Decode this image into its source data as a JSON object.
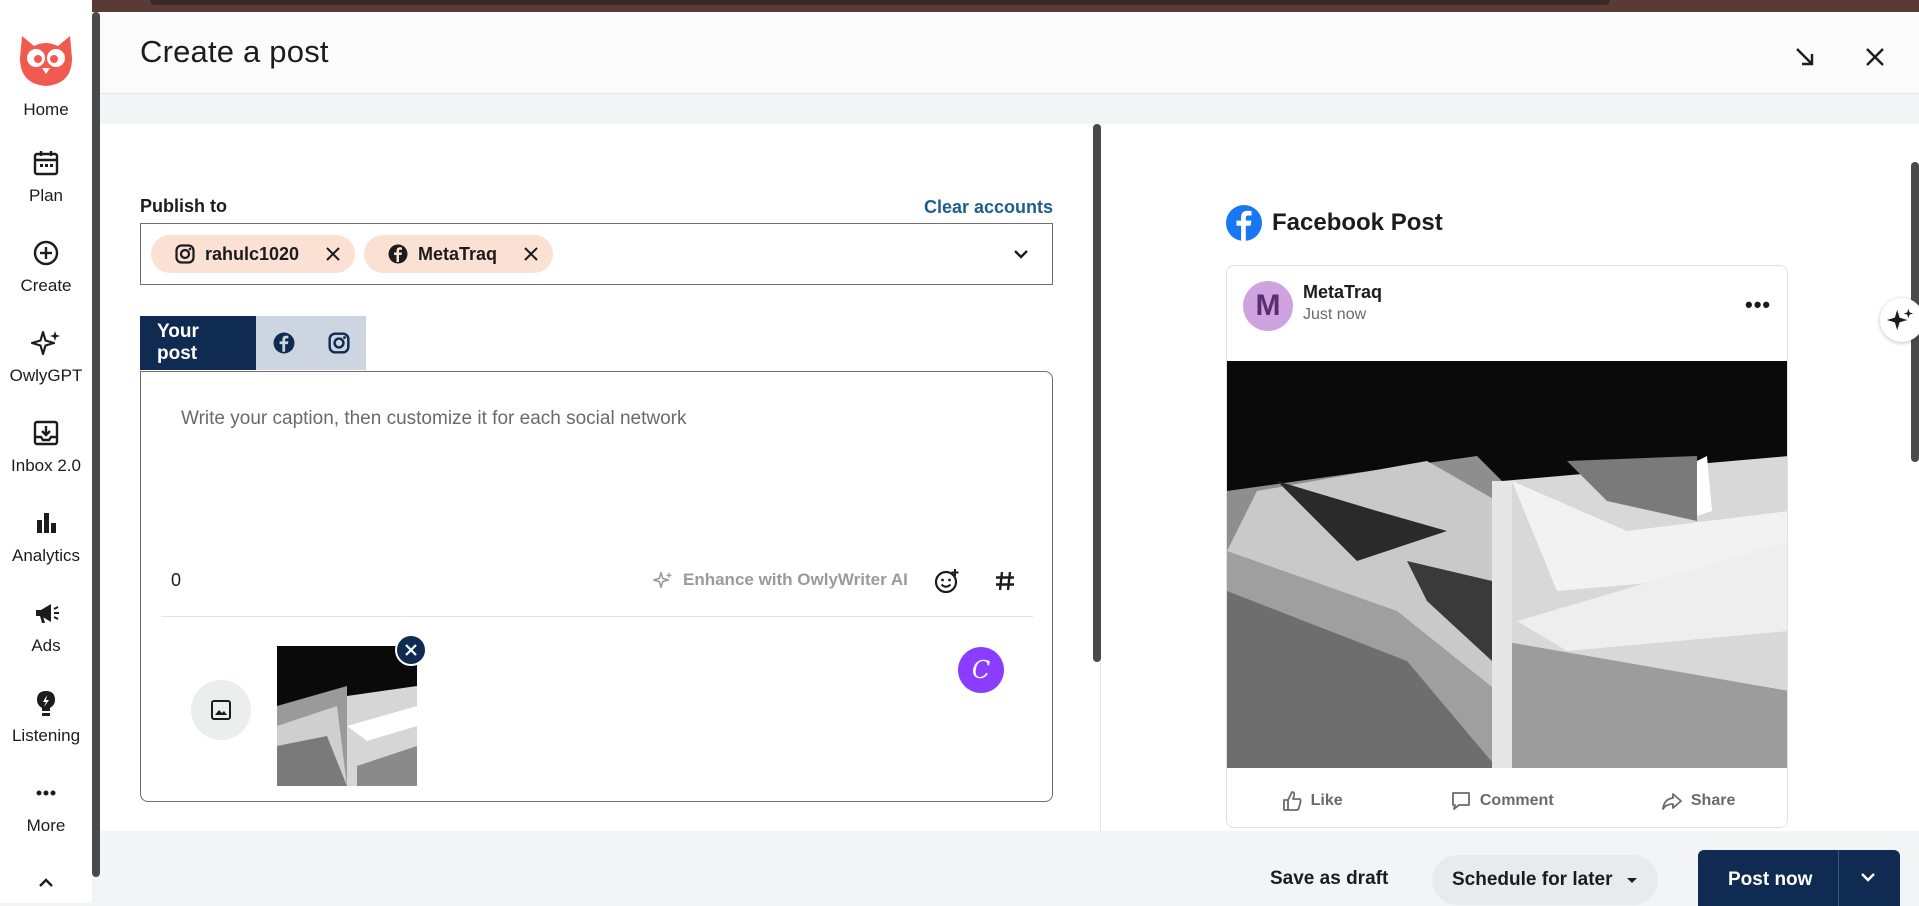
{
  "sidebar": {
    "items": [
      {
        "label": "Home",
        "icon": "owl-logo-icon"
      },
      {
        "label": "Plan",
        "icon": "calendar-icon"
      },
      {
        "label": "Create",
        "icon": "plus-circle-icon"
      },
      {
        "label": "OwlyGPT",
        "icon": "sparkle-icon"
      },
      {
        "label": "Inbox 2.0",
        "icon": "inbox-icon"
      },
      {
        "label": "Analytics",
        "icon": "bar-chart-icon"
      },
      {
        "label": "Ads",
        "icon": "megaphone-icon"
      },
      {
        "label": "Listening",
        "icon": "lightbulb-icon"
      },
      {
        "label": "More",
        "icon": "ellipsis-icon"
      }
    ]
  },
  "header": {
    "title": "Create a post"
  },
  "publish": {
    "label": "Publish to",
    "clear_label": "Clear accounts",
    "accounts": [
      {
        "name": "rahulc1020",
        "network": "instagram"
      },
      {
        "name": "MetaTraq",
        "network": "facebook"
      }
    ]
  },
  "tabs": {
    "your_post": "Your post"
  },
  "composer": {
    "placeholder": "Write your caption, then customize it for each social network",
    "char_count": "0",
    "enhance_label": "Enhance with OwlyWriter AI",
    "canva_letter": "C"
  },
  "preview": {
    "title": "Facebook Post",
    "page_name": "MetaTraq",
    "avatar_letter": "M",
    "time": "Just now",
    "actions": {
      "like": "Like",
      "comment": "Comment",
      "share": "Share"
    }
  },
  "footer": {
    "draft_label": "Save as draft",
    "schedule_label": "Schedule for later",
    "post_label": "Post now"
  },
  "colors": {
    "brand_red": "#f15a4e",
    "navy": "#0f2b52",
    "chip_bg": "#fbe0d4",
    "facebook_blue": "#1877f2",
    "canva_purple": "#8b3dff"
  }
}
